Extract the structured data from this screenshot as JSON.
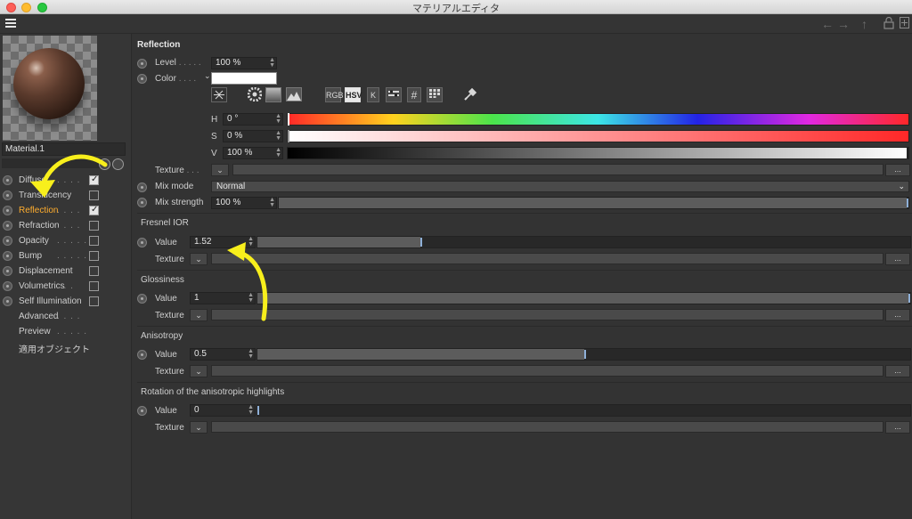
{
  "window": {
    "title": "マテリアルエディタ"
  },
  "toolbar": {
    "back_icon": "←",
    "forward_icon": "→",
    "up_icon": "↑",
    "lock_icon": "🔓",
    "new_icon": "⊞"
  },
  "sidebar": {
    "material_name": "Material.1",
    "channels": [
      {
        "label": "Diffuse",
        "dots": ". . . .",
        "checked": true,
        "active": false
      },
      {
        "label": "Translucency",
        "dots": ". .",
        "checked": false,
        "active": false
      },
      {
        "label": "Reflection",
        "dots": ". . . .",
        "checked": true,
        "active": true
      },
      {
        "label": "Refraction",
        "dots": ". . . .",
        "checked": false,
        "active": false
      },
      {
        "label": "Opacity",
        "dots": ". . . . . .",
        "checked": false,
        "active": false
      },
      {
        "label": "Bump",
        "dots": ". . . . . . .",
        "checked": false,
        "active": false
      },
      {
        "label": "Displacement",
        "dots": ". .",
        "checked": false,
        "active": false
      },
      {
        "label": "Volumetrics",
        "dots": ". . .",
        "checked": false,
        "active": false
      },
      {
        "label": "Self Illumination",
        "dots": "",
        "checked": false,
        "active": false
      },
      {
        "label": "Advanced",
        "dots": ". . . .",
        "checked": null,
        "active": false
      },
      {
        "label": "Preview",
        "dots": ". . . . .",
        "checked": null,
        "active": false
      },
      {
        "label": "適用オブジェクト",
        "dots": "",
        "checked": null,
        "active": false
      }
    ]
  },
  "reflection": {
    "title": "Reflection",
    "level_label": "Level",
    "level_dots": ". . . . .",
    "level_value": "100 %",
    "color_label": "Color",
    "color_dots": ". . . .",
    "color_value": "#ffffff",
    "color_modes": [
      "RGB",
      "HSV",
      "K"
    ],
    "color_mode_icon": "#",
    "h_label": "H",
    "h_value": "0 °",
    "s_label": "S",
    "s_value": "0 %",
    "v_label": "V",
    "v_value": "100 %",
    "texture_label": "Texture",
    "texture_dots": ". . .",
    "more_label": "...",
    "mix_mode_label": "Mix mode",
    "mix_mode_value": "Normal",
    "mix_strength_label": "Mix strength",
    "mix_strength_value": "100 %",
    "mix_strength_fraction": 1.0
  },
  "fresnel": {
    "title": "Fresnel IOR",
    "value_label": "Value",
    "value": "1.52",
    "fraction": 0.25,
    "texture_label": "Texture"
  },
  "glossiness": {
    "title": "Glossiness",
    "value_label": "Value",
    "value": "1",
    "fraction": 1.0,
    "texture_label": "Texture"
  },
  "anisotropy": {
    "title": "Anisotropy",
    "value_label": "Value",
    "value": "0.5",
    "fraction": 0.5,
    "texture_label": "Texture"
  },
  "rotation": {
    "title": "Rotation of the anisotropic highlights",
    "value_label": "Value",
    "value": "0",
    "fraction": 0.0,
    "texture_label": "Texture"
  },
  "colors": {
    "accent_active": "#ffad2e",
    "arrow": "#f8ef1c"
  }
}
